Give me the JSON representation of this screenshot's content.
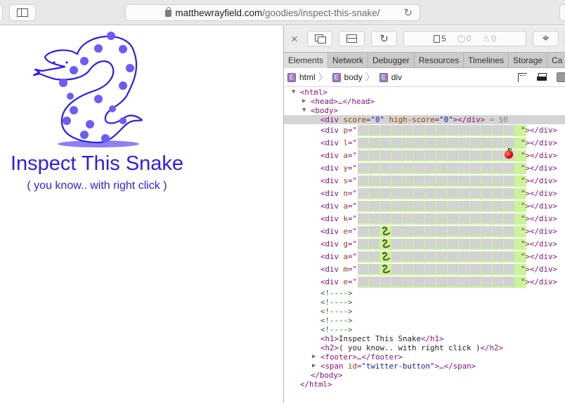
{
  "browser": {
    "url_host": "matthewrayfield.com",
    "url_path": "/goodies/inspect-this-snake/"
  },
  "page": {
    "title": "Inspect This Snake",
    "subtitle": "( you know.. with right click )",
    "accent_color": "#2a1df2"
  },
  "devtools": {
    "counts": {
      "resources": "5",
      "errors": "0",
      "warnings": "0"
    },
    "tabs": [
      {
        "label": "Elements",
        "active": true
      },
      {
        "label": "Network",
        "active": false
      },
      {
        "label": "Debugger",
        "active": false
      },
      {
        "label": "Resources",
        "active": false
      },
      {
        "label": "Timelines",
        "active": false
      },
      {
        "label": "Storage",
        "active": false
      },
      {
        "label": "Ca",
        "active": false
      }
    ],
    "breadcrumbs": [
      {
        "badge": "E",
        "label": "html"
      },
      {
        "badge": "E",
        "label": "body"
      },
      {
        "badge": "E",
        "label": "div"
      }
    ],
    "tree": {
      "html_open": "<html>",
      "head": "<head>…</head>",
      "body_open": "<body>",
      "score_div": {
        "open": "<div ",
        "score_attr": "score",
        "score_val": "\"0\"",
        "high_attr": " high-score",
        "high_val": "\"0\"",
        "close": "></div>",
        "console_ref": " = $0"
      },
      "grid_rows": [
        {
          "attr": "p",
          "snake_cols": [],
          "apple_col": null
        },
        {
          "attr": "l",
          "snake_cols": [],
          "apple_col": null
        },
        {
          "attr": "a",
          "snake_cols": [],
          "apple_col": 13
        },
        {
          "attr": "y",
          "snake_cols": [],
          "apple_col": null
        },
        {
          "attr": "s",
          "snake_cols": [],
          "apple_col": null
        },
        {
          "attr": "n",
          "snake_cols": [],
          "apple_col": null
        },
        {
          "attr": "a",
          "snake_cols": [],
          "apple_col": null
        },
        {
          "attr": "k",
          "snake_cols": [],
          "apple_col": null
        },
        {
          "attr": "e",
          "snake_cols": [
            2
          ],
          "apple_col": null
        },
        {
          "attr": "g",
          "snake_cols": [
            2
          ],
          "apple_col": null
        },
        {
          "attr": "a",
          "snake_cols": [
            2
          ],
          "apple_col": null
        },
        {
          "attr": "m",
          "snake_cols": [
            2
          ],
          "apple_col": null
        },
        {
          "attr": "e",
          "snake_cols": [],
          "apple_col": null
        }
      ],
      "grid_columns": 15,
      "row_prefix": "<div ",
      "row_eq": "=\"",
      "row_suffix": "\"></div>",
      "comments": [
        "<!---->",
        "<!---->",
        "<!---->",
        "<!---->",
        "<!---->"
      ],
      "h1": {
        "open": "<h1>",
        "text": "Inspect This Snake",
        "close": "</h1>"
      },
      "h2": {
        "open": "<h2>",
        "text": "( you know.. with right click )",
        "close": "</h2>"
      },
      "footer": "<footer>…</footer>",
      "span": {
        "open": "<span ",
        "attr": "id",
        "val": "\"twitter-button\"",
        "close": ">…</span>"
      },
      "body_close": "</body>",
      "html_close": "</html>"
    },
    "colors": {
      "grid_cell": "#d2d2d2",
      "grid_snake": "#c9f597",
      "tag": "#881280",
      "attr": "#994500",
      "value": "#1a1aa6",
      "comment": "#236e25"
    }
  }
}
